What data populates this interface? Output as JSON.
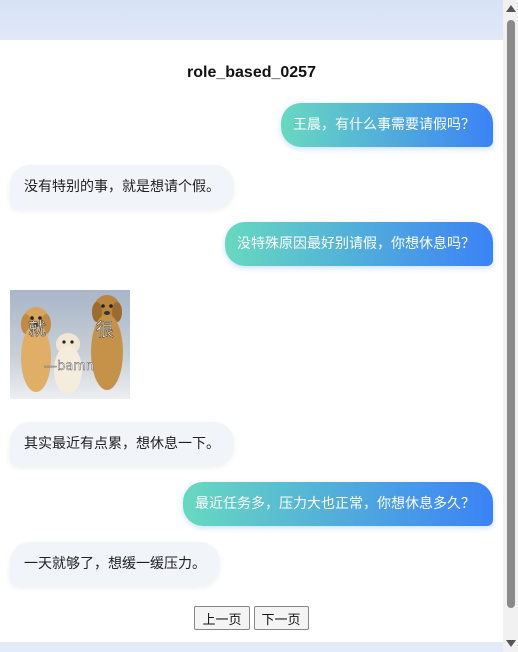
{
  "chat": {
    "title": "role_based_0257",
    "messages": [
      {
        "role": "user",
        "text": "王晨，有什么事需要请假吗？"
      },
      {
        "role": "bot",
        "text": "没有特别的事，就是想请个假。"
      },
      {
        "role": "user",
        "text": "没特殊原因最好别请假，你想休息吗？"
      },
      {
        "role": "bot",
        "type": "sticker",
        "caption_left": "就",
        "caption_right": "很",
        "caption_bottom": "—bamn"
      },
      {
        "role": "bot",
        "text": "其实最近有点累，想休息一下。"
      },
      {
        "role": "user",
        "text": "最近任务多，压力大也正常，你想休息多久？"
      },
      {
        "role": "bot",
        "text": "一天就够了，想缓一缓压力。"
      }
    ]
  },
  "pager": {
    "prev_label": "上一页",
    "next_label": "下一页"
  },
  "colors": {
    "user_gradient_start": "#67d9c0",
    "user_gradient_end": "#3b82f6",
    "bot_bubble": "#f1f4f9"
  }
}
